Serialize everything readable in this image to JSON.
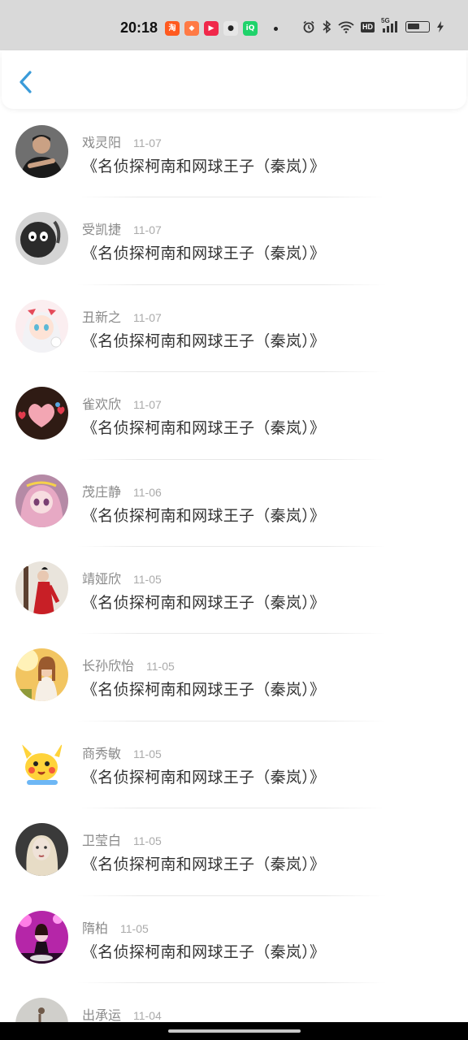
{
  "status_bar": {
    "time": "20:18",
    "app_icons": [
      {
        "name": "taobao-app-icon",
        "glyph": "淘",
        "bg": "#ff5a1f",
        "fg": "#ffffff"
      },
      {
        "name": "game-app-icon",
        "glyph": "◆",
        "bg": "#ff7a45",
        "fg": "#ffffff"
      },
      {
        "name": "video-app-icon",
        "glyph": "▶",
        "bg": "#f0284a",
        "fg": "#ffffff"
      },
      {
        "name": "wechat-app-icon",
        "glyph": "●",
        "bg": "#e6e6e6",
        "fg": "#222222"
      },
      {
        "name": "iqiyi-app-icon",
        "glyph": "iQ",
        "bg": "#1fd36b",
        "fg": "#ffffff"
      }
    ],
    "hd_label": "HD",
    "network_label": "5G",
    "battery_level": 0.6
  },
  "header": {
    "back_icon": "chevron-left-icon",
    "accent_color": "#3a9bd9"
  },
  "comments": [
    {
      "name": "戏灵阳",
      "date": "11-07",
      "content": "《名侦探柯南和网球王子（秦岚）》",
      "avatar": "man-dark-shirt"
    },
    {
      "name": "受凯捷",
      "date": "11-07",
      "content": "《名侦探柯南和网球王子（秦岚）》",
      "avatar": "dark-cartoon"
    },
    {
      "name": "丑新之",
      "date": "11-07",
      "content": "《名侦探柯南和网球王子（秦岚）》",
      "avatar": "anime-girl-white"
    },
    {
      "name": "雀欢欣",
      "date": "11-07",
      "content": "《名侦探柯南和网球王子（秦岚）》",
      "avatar": "pink-hearts"
    },
    {
      "name": "茂庄静",
      "date": "11-06",
      "content": "《名侦探柯南和网球王子（秦岚）》",
      "avatar": "anime-girl-pink"
    },
    {
      "name": "靖娅欣",
      "date": "11-05",
      "content": "《名侦探柯南和网球王子（秦岚）》",
      "avatar": "red-costume"
    },
    {
      "name": "长孙欣怡",
      "date": "11-05",
      "content": "《名侦探柯南和网球王子（秦岚）》",
      "avatar": "golden-portrait"
    },
    {
      "name": "商秀敏",
      "date": "11-05",
      "content": "《名侦探柯南和网球王子（秦岚）》",
      "avatar": "pikachu"
    },
    {
      "name": "卫莹白",
      "date": "11-05",
      "content": "《名侦探柯南和网球王子（秦岚）》",
      "avatar": "blonde-dark"
    },
    {
      "name": "隋柏",
      "date": "11-05",
      "content": "《名侦探柯南和网球王子（秦岚）》",
      "avatar": "magenta-party"
    },
    {
      "name": "出承运",
      "date": "11-04",
      "content": "",
      "avatar": "gray-partial"
    }
  ]
}
